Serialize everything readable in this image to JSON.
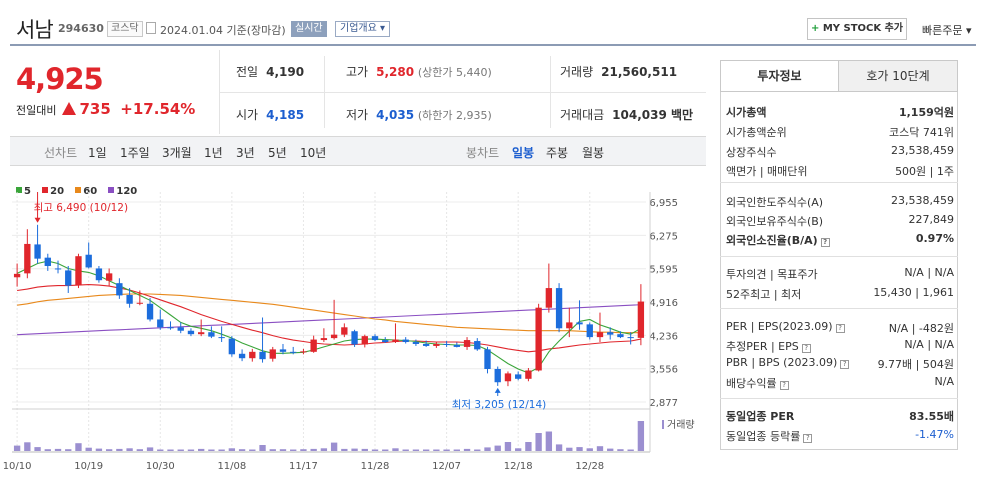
{
  "header": {
    "name": "서남",
    "code": "294630",
    "market": "코스닥",
    "date_text": "2024.01.04  기준(장마감)",
    "realtime": "실시간",
    "company_info": "기업개요 ▾",
    "mystock": "MY STOCK 추가",
    "mystock_plus": "+",
    "quick_order": "빠른주문 ▾"
  },
  "price": {
    "current": "4,925",
    "change_label": "전일대비",
    "change": "735",
    "change_pct": "+17.54%"
  },
  "quote": {
    "prev_label": "전일",
    "prev": "4,190",
    "high_label": "고가",
    "high": "5,280",
    "high_limit": "(상한가 5,440)",
    "volume_label": "거래량",
    "volume": "21,560,511",
    "open_label": "시가",
    "open": "4,185",
    "low_label": "저가",
    "low": "4,035",
    "low_limit": "(하한가 2,935)",
    "amount_label": "거래대금",
    "amount": "104,039 백만"
  },
  "periods": {
    "line_label": "선차트",
    "items": [
      "1일",
      "1주일",
      "3개월",
      "1년",
      "3년",
      "5년",
      "10년"
    ],
    "candle_label": "봉차트",
    "candle_items": [
      "일봉",
      "주봉",
      "월봉"
    ],
    "active": "일봉"
  },
  "tabs": {
    "invest": "투자정보",
    "quote10": "호가 10단계"
  },
  "invest": {
    "rows1": [
      {
        "l": "시가총액",
        "r": "1,159억원",
        "bold": true
      },
      {
        "l": "시가총액순위",
        "r": "코스닥 741위"
      },
      {
        "l": "상장주식수",
        "r": "23,538,459"
      },
      {
        "l": "액면가 | 매매단위",
        "r": "500원 | 1주"
      }
    ],
    "rows2": [
      {
        "l": "외국인한도주식수(A)",
        "r": "23,538,459"
      },
      {
        "l": "외국인보유주식수(B)",
        "r": "227,849"
      },
      {
        "l": "외국인소진율(B/A)",
        "r": "0.97%",
        "bold": true
      }
    ],
    "rows3": [
      {
        "l": "투자의견 | 목표주가",
        "r": "N/A | N/A"
      },
      {
        "l": "52주최고 | 최저",
        "r": "15,430 | 1,961"
      }
    ],
    "rows4": [
      {
        "l": "PER | EPS(2023.09)",
        "r": "N/A | -482원"
      },
      {
        "l": "추정PER | EPS",
        "r": "N/A | N/A"
      },
      {
        "l": "PBR | BPS (2023.09)",
        "r": "9.77배 | 504원"
      },
      {
        "l": "배당수익률",
        "r": "N/A"
      }
    ],
    "rows5": [
      {
        "l": "동일업종 PER",
        "r": "83.55배",
        "bold": true
      },
      {
        "l": "동일업종 등락률",
        "r": "-1.47%",
        "neg": true
      }
    ]
  },
  "chart_data": {
    "type": "candlestick",
    "legend": [
      {
        "name": "5",
        "color": "#3aa53a"
      },
      {
        "name": "20",
        "color": "#e0262c"
      },
      {
        "name": "60",
        "color": "#e8891c"
      },
      {
        "name": "120",
        "color": "#8a4fc2"
      }
    ],
    "y_ticks": [
      2877,
      3556,
      4236,
      4916,
      5595,
      6275,
      6955
    ],
    "y_tick_labels": [
      "2,877",
      "3,556",
      "4,236",
      "4,916",
      "5,595",
      "6,275",
      "6,955"
    ],
    "ylim": [
      2877,
      6955
    ],
    "x_tick_labels": [
      "10/10",
      "10/19",
      "10/30",
      "11/08",
      "11/17",
      "11/28",
      "12/07",
      "12/18",
      "12/28"
    ],
    "x_tick_index": [
      0,
      7,
      14,
      21,
      28,
      35,
      42,
      49,
      56
    ],
    "volume_label": "거래량",
    "high_annotation": "최고 6,490 (10/12)",
    "low_annotation": "최저 3,205 (12/14)",
    "candles": [
      [
        5420,
        5700,
        5230,
        5490
      ],
      [
        5500,
        6400,
        5400,
        6100
      ],
      [
        6090,
        6490,
        5700,
        5800
      ],
      [
        5820,
        5900,
        5550,
        5650
      ],
      [
        5600,
        5760,
        5500,
        5580
      ],
      [
        5560,
        5650,
        5100,
        5250
      ],
      [
        5260,
        5900,
        5200,
        5850
      ],
      [
        5880,
        6130,
        5600,
        5620
      ],
      [
        5600,
        5650,
        5310,
        5360
      ],
      [
        5350,
        5600,
        5250,
        5500
      ],
      [
        5300,
        5400,
        4980,
        5050
      ],
      [
        5060,
        5200,
        4800,
        4880
      ],
      [
        4900,
        5150,
        4850,
        4900
      ],
      [
        4880,
        5000,
        4520,
        4560
      ],
      [
        4560,
        4760,
        4350,
        4400
      ],
      [
        4400,
        4520,
        4350,
        4380
      ],
      [
        4400,
        4500,
        4280,
        4330
      ],
      [
        4330,
        4380,
        4220,
        4260
      ],
      [
        4260,
        4560,
        4220,
        4300
      ],
      [
        4300,
        4420,
        4180,
        4210
      ],
      [
        4200,
        4420,
        4100,
        4180
      ],
      [
        4170,
        4220,
        3800,
        3850
      ],
      [
        3860,
        3950,
        3710,
        3770
      ],
      [
        3770,
        3960,
        3700,
        3900
      ],
      [
        3900,
        4600,
        3680,
        3750
      ],
      [
        3760,
        4000,
        3700,
        3950
      ],
      [
        3950,
        4060,
        3850,
        3900
      ],
      [
        3900,
        4000,
        3850,
        3880
      ],
      [
        3890,
        3960,
        3850,
        3910
      ],
      [
        3900,
        4230,
        3880,
        4150
      ],
      [
        4140,
        4380,
        4100,
        4180
      ],
      [
        4180,
        4960,
        4150,
        4250
      ],
      [
        4250,
        4480,
        4200,
        4400
      ],
      [
        4320,
        4350,
        4000,
        4050
      ],
      [
        4050,
        4250,
        3990,
        4220
      ],
      [
        4220,
        4260,
        4120,
        4140
      ],
      [
        4140,
        4200,
        4080,
        4100
      ],
      [
        4100,
        4480,
        4080,
        4150
      ],
      [
        4150,
        4200,
        4070,
        4100
      ],
      [
        4100,
        4150,
        4020,
        4060
      ],
      [
        4060,
        4130,
        4000,
        4020
      ],
      [
        4020,
        4100,
        3980,
        4060
      ],
      [
        4060,
        4120,
        4000,
        4040
      ],
      [
        4040,
        4090,
        3990,
        4000
      ],
      [
        4000,
        4200,
        3940,
        4140
      ],
      [
        4120,
        4180,
        3920,
        3950
      ],
      [
        3950,
        4000,
        3460,
        3550
      ],
      [
        3550,
        3600,
        3205,
        3280
      ],
      [
        3300,
        3500,
        3200,
        3460
      ],
      [
        3440,
        3500,
        3320,
        3350
      ],
      [
        3350,
        3570,
        3300,
        3520
      ],
      [
        3520,
        4880,
        3500,
        4800
      ],
      [
        4800,
        5700,
        4700,
        5200
      ],
      [
        5200,
        5300,
        4300,
        4380
      ],
      [
        4380,
        4800,
        4200,
        4500
      ],
      [
        4500,
        4950,
        4350,
        4460
      ],
      [
        4460,
        4500,
        4150,
        4200
      ],
      [
        4200,
        4700,
        4100,
        4300
      ],
      [
        4300,
        4400,
        4150,
        4250
      ],
      [
        4260,
        4320,
        4180,
        4200
      ],
      [
        4200,
        4300,
        4050,
        4190
      ],
      [
        4185,
        5280,
        4035,
        4925
      ]
    ],
    "volumes": [
      18,
      29,
      13,
      6,
      7,
      6,
      26,
      11,
      8,
      6,
      7,
      9,
      6,
      12,
      5,
      5,
      5,
      5,
      7,
      5,
      5,
      9,
      6,
      5,
      20,
      6,
      6,
      5,
      6,
      7,
      9,
      28,
      7,
      8,
      7,
      5,
      5,
      9,
      5,
      5,
      5,
      5,
      5,
      5,
      7,
      5,
      12,
      18,
      30,
      9,
      30,
      60,
      65,
      22,
      11,
      13,
      9,
      16,
      8,
      6,
      5,
      100
    ],
    "ma5": [
      5500,
      5600,
      5700,
      5750,
      5700,
      5600,
      5550,
      5520,
      5450,
      5350,
      5250,
      5150,
      5050,
      4950,
      4800,
      4650,
      4500,
      4420,
      4380,
      4330,
      4260,
      4180,
      4080,
      4000,
      3920,
      3870,
      3870,
      3880,
      3890,
      3940,
      4000,
      4060,
      4120,
      4150,
      4160,
      4160,
      4150,
      4140,
      4130,
      4110,
      4080,
      4060,
      4050,
      4040,
      4040,
      4030,
      3940,
      3800,
      3660,
      3550,
      3470,
      3580,
      3900,
      4120,
      4320,
      4520,
      4560,
      4450,
      4380,
      4300,
      4260,
      4380
    ],
    "ma20": [
      5150,
      5180,
      5220,
      5240,
      5250,
      5250,
      5260,
      5270,
      5260,
      5240,
      5200,
      5160,
      5100,
      5030,
      4960,
      4890,
      4820,
      4740,
      4660,
      4590,
      4520,
      4460,
      4400,
      4340,
      4290,
      4230,
      4180,
      4140,
      4110,
      4080,
      4060,
      4050,
      4040,
      4050,
      4060,
      4080,
      4090,
      4110,
      4120,
      4120,
      4110,
      4100,
      4100,
      4100,
      4090,
      4070,
      4040,
      4000,
      3960,
      3930,
      3900,
      3920,
      3960,
      3980,
      4010,
      4040,
      4060,
      4080,
      4100,
      4110,
      4120,
      4160
    ],
    "ma60": [
      4850,
      4880,
      4920,
      4950,
      4970,
      4990,
      5010,
      5030,
      5050,
      5060,
      5070,
      5080,
      5080,
      5080,
      5070,
      5060,
      5050,
      5030,
      5010,
      4990,
      4970,
      4950,
      4930,
      4910,
      4890,
      4870,
      4840,
      4810,
      4780,
      4750,
      4720,
      4690,
      4660,
      4630,
      4600,
      4570,
      4550,
      4520,
      4500,
      4480,
      4460,
      4440,
      4420,
      4400,
      4390,
      4380,
      4370,
      4360,
      4350,
      4340,
      4330,
      4330,
      4330,
      4330,
      4330,
      4320,
      4310,
      4300,
      4300,
      4290,
      4290,
      4290
    ],
    "ma120": [
      4250,
      4260,
      4270,
      4280,
      4290,
      4300,
      4310,
      4320,
      4330,
      4340,
      4350,
      4360,
      4370,
      4380,
      4390,
      4400,
      4410,
      4420,
      4430,
      4440,
      4450,
      4460,
      4470,
      4480,
      4490,
      4500,
      4510,
      4520,
      4530,
      4540,
      4550,
      4560,
      4570,
      4580,
      4590,
      4600,
      4610,
      4620,
      4630,
      4640,
      4650,
      4660,
      4670,
      4680,
      4690,
      4700,
      4710,
      4720,
      4730,
      4740,
      4750,
      4760,
      4770,
      4780,
      4790,
      4800,
      4810,
      4820,
      4830,
      4840,
      4850,
      4860
    ]
  }
}
